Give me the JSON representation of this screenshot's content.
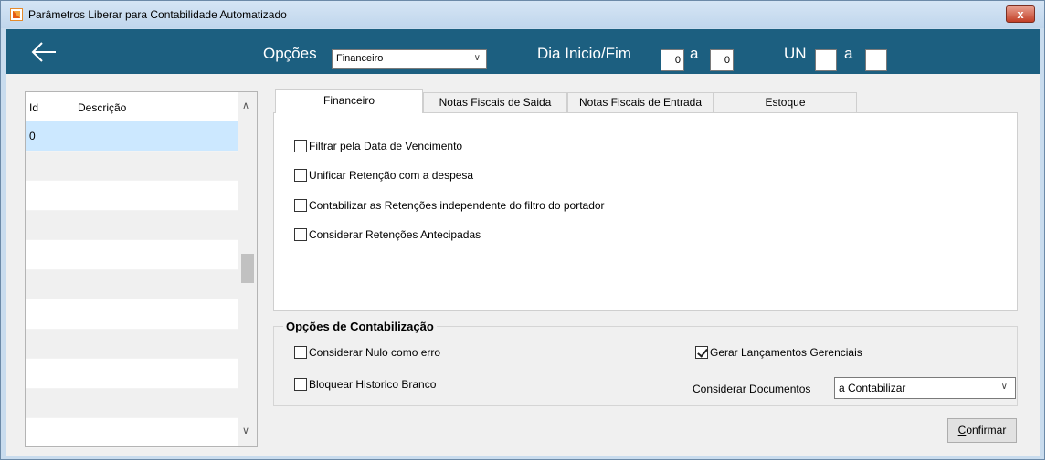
{
  "window": {
    "title": "Parâmetros Liberar para Contabilidade Automatizado",
    "close_glyph": "x"
  },
  "header": {
    "back_icon": "back-arrow-icon",
    "opcoes_label": "Opções",
    "opcoes_value": "Financeiro",
    "dia_label": "Dia Inicio/Fim",
    "dia_inicio": "0",
    "a1": "a",
    "dia_fim": "0",
    "un_label": "UN",
    "un_inicio": "",
    "a2": "a",
    "un_fim": "",
    "bg_color": "#1c5f80"
  },
  "grid": {
    "columns": [
      "Id",
      "Descrição"
    ],
    "rows": [
      {
        "id": "0",
        "descricao": "",
        "selected": true
      },
      {
        "id": "",
        "descricao": ""
      },
      {
        "id": "",
        "descricao": ""
      },
      {
        "id": "",
        "descricao": ""
      },
      {
        "id": "",
        "descricao": ""
      },
      {
        "id": "",
        "descricao": ""
      },
      {
        "id": "",
        "descricao": ""
      },
      {
        "id": "",
        "descricao": ""
      },
      {
        "id": "",
        "descricao": ""
      },
      {
        "id": "",
        "descricao": ""
      },
      {
        "id": "",
        "descricao": ""
      }
    ]
  },
  "tabs": [
    {
      "label": "Financeiro",
      "active": true
    },
    {
      "label": "Notas Fiscais de Saida"
    },
    {
      "label": "Notas Fiscais de Entrada"
    },
    {
      "label": "Estoque"
    }
  ],
  "financeiro_options": [
    {
      "label": "Filtrar pela Data de Vencimento",
      "checked": false
    },
    {
      "label": "Unificar Retenção com a despesa",
      "checked": false
    },
    {
      "label": "Contabilizar as Retenções independente do filtro do portador",
      "checked": false
    },
    {
      "label": "Considerar Retenções Antecipadas",
      "checked": false
    }
  ],
  "contabilizacao": {
    "title": "Opções de Contabilização",
    "nulo_erro": {
      "label": "Considerar Nulo como erro",
      "checked": false
    },
    "historico_branco": {
      "label": "Bloquear Historico Branco",
      "checked": false
    },
    "gerenciais": {
      "label": "Gerar Lançamentos Gerenciais",
      "checked": true
    },
    "documentos_label": "Considerar Documentos",
    "documentos_value": "a Contabilizar"
  },
  "confirm": {
    "underline_char": "C",
    "rest": "onfirmar"
  }
}
